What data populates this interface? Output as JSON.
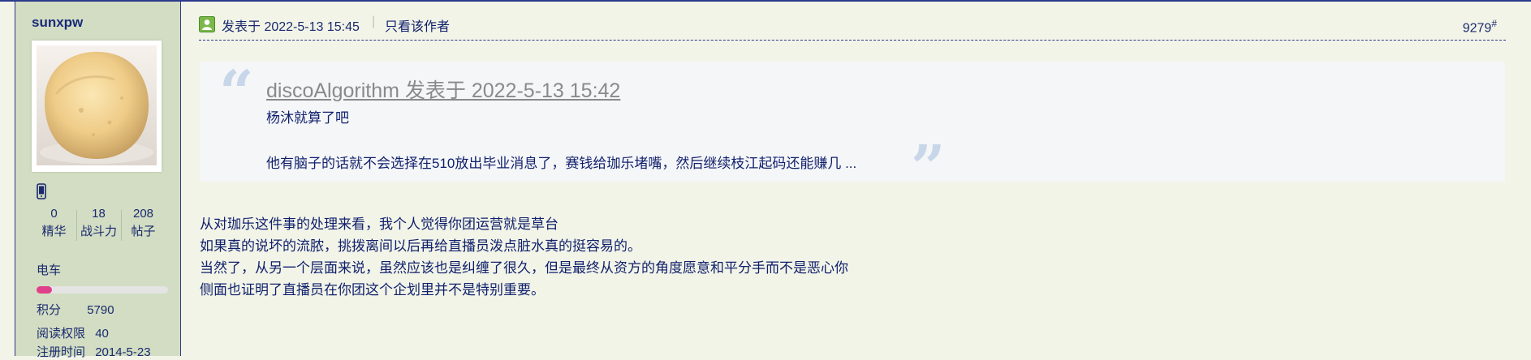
{
  "author": {
    "username": "sunxpw",
    "avatar_alt": "ice cream avatar",
    "device_icon": "mobile-phone-icon",
    "stats": [
      {
        "value": "0",
        "label": "精华"
      },
      {
        "value": "18",
        "label": "战斗力"
      },
      {
        "value": "208",
        "label": "帖子"
      }
    ],
    "group": "电车",
    "level_progress": 0.12,
    "level_color": "#e0408a",
    "points_label": "积分",
    "points_value": "5790",
    "read_perm_label": "阅读权限",
    "read_perm_value": "40",
    "reg_label": "注册时间",
    "reg_value": "2014-5-23"
  },
  "post": {
    "posted_at": "发表于 2022-5-13 15:45",
    "separator": "|",
    "only_author": "只看该作者",
    "floor_number": "9279",
    "floor_suffix": "#",
    "quote": {
      "header": "discoAlgorithm 发表于 2022-5-13 15:42",
      "line1": "杨沐就算了吧",
      "line2": "他有脑子的话就不会选择在510放出毕业消息了，赛钱给珈乐堵嘴，然后继续枝江起码还能赚几 ...",
      "open_mark": "“",
      "close_mark": "”"
    },
    "body_lines": [
      "从对珈乐这件事的处理来看，我个人觉得你团运营就是草台",
      "如果真的说坏的流脓，挑拨离间以后再给直播员泼点脏水真的挺容易的。",
      "当然了，从另一个层面来说，虽然应该也是纠缠了很久，但是最终从资方的角度愿意和平分手而不是恶心你",
      "侧面也证明了直播员在你团这个企划里并不是特别重要。"
    ]
  }
}
